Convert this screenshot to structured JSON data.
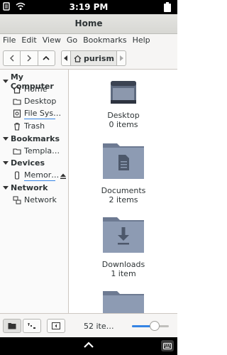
{
  "status_bar": {
    "time": "3:19 PM"
  },
  "window": {
    "title": "Home"
  },
  "menu": [
    "File",
    "Edit",
    "View",
    "Go",
    "Bookmarks",
    "Help"
  ],
  "path_bar": {
    "current": "purism"
  },
  "sidebar": {
    "sections": [
      {
        "heading": "My Computer",
        "items": [
          "Home",
          "Desktop",
          "File Sys…",
          "Trash"
        ]
      },
      {
        "heading": "Bookmarks",
        "items": [
          "Templa…"
        ]
      },
      {
        "heading": "Devices",
        "items": [
          "Memor…"
        ]
      },
      {
        "heading": "Network",
        "items": [
          "Network"
        ]
      }
    ]
  },
  "content": {
    "items": [
      {
        "name": "Desktop",
        "count": "0 items",
        "icon": "desktop-folder-icon"
      },
      {
        "name": "Documents",
        "count": "2 items",
        "icon": "documents-folder-icon"
      },
      {
        "name": "Downloads",
        "count": "1 item",
        "icon": "downloads-folder-icon"
      },
      {
        "name": "",
        "count": "",
        "icon": "folder-icon"
      }
    ]
  },
  "statusbar_bottom": {
    "item_count": "52 ite…",
    "zoom_level": 0.62
  },
  "colors": {
    "accent": "#3584e4",
    "folder": "#8d9bb3"
  }
}
